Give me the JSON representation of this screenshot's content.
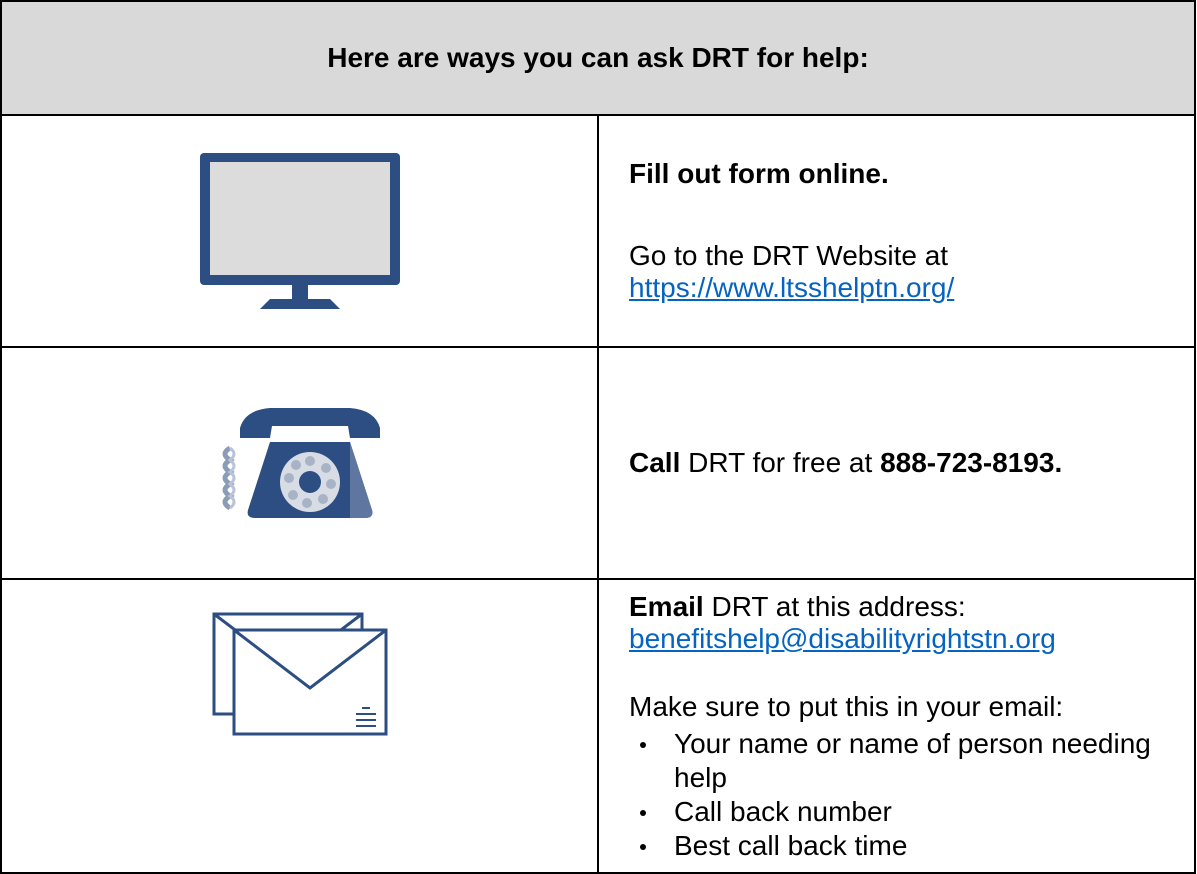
{
  "header": {
    "title": "Here are ways you can ask DRT for help:"
  },
  "online": {
    "heading": "Fill out form online.",
    "text": "Go to the DRT Website at",
    "link": "https://www.ltsshelptn.org/"
  },
  "call": {
    "bold_lead": "Call",
    "text": " DRT for free at ",
    "number": "888-723-8193."
  },
  "email": {
    "bold_lead": "Email",
    "text": " DRT at this address: ",
    "address": "benefitshelp@disabilityrightstn.org",
    "prompt": "Make sure to put this in your email:",
    "items": [
      "Your name or name of person needing help",
      "Call back number",
      "Best call back time"
    ]
  },
  "icons": {
    "online": "monitor-icon",
    "call": "rotary-phone-icon",
    "email": "envelopes-icon"
  },
  "colors": {
    "icon_blue": "#2d4e82",
    "screen_gray": "#dcdcdc",
    "header_bg": "#d9d9d9",
    "link": "#0563c1"
  }
}
